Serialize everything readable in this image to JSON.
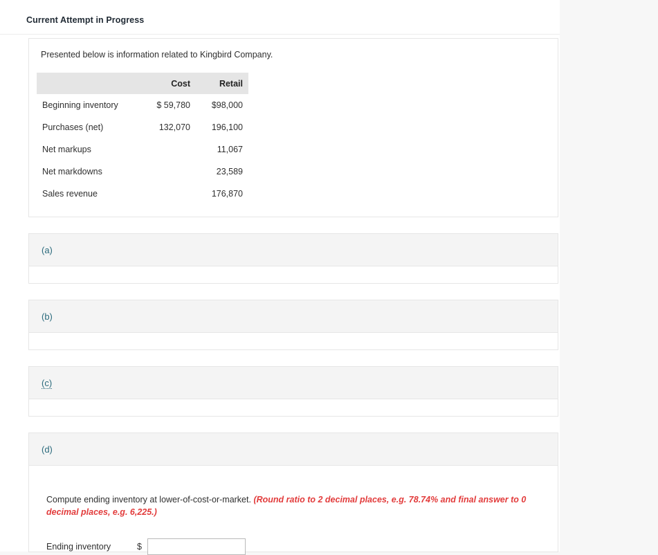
{
  "header": {
    "attempt_status": "Current Attempt in Progress"
  },
  "info_card": {
    "intro_text": "Presented below is information related to Kingbird Company.",
    "table": {
      "columns": [
        "",
        "Cost",
        "Retail"
      ],
      "rows": [
        {
          "label": "Beginning inventory",
          "cost": "$ 59,780",
          "retail": "$98,000"
        },
        {
          "label": "Purchases (net)",
          "cost": "132,070",
          "retail": "196,100"
        },
        {
          "label": "Net markups",
          "cost": "",
          "retail": "11,067"
        },
        {
          "label": "Net markdowns",
          "cost": "",
          "retail": "23,589"
        },
        {
          "label": "Sales revenue",
          "cost": "",
          "retail": "176,870"
        }
      ]
    }
  },
  "sections": [
    {
      "letter": "(a)",
      "linked": false
    },
    {
      "letter": "(b)",
      "linked": false
    },
    {
      "letter": "(c)",
      "linked": true
    },
    {
      "letter": "(d)",
      "linked": false
    }
  ],
  "section_d": {
    "letter": "(d)",
    "prompt": "Compute ending inventory at lower-of-cost-or-market.",
    "hint": "(Round ratio to 2 decimal places, e.g. 78.74% and final answer to 0 decimal places, e.g. 6,225.)",
    "answer_label": "Ending inventory",
    "currency_symbol": "$",
    "answer_value": "",
    "answer_placeholder": ""
  },
  "colors": {
    "page_background": "#f7f7f7",
    "content_background": "#ffffff",
    "section_header": "#f4f4f4",
    "table_header": "#e5e5e5",
    "border": "#e6e6e6",
    "letter_link": "#2a6a7c",
    "hint_red": "#e23b3b",
    "text": "#2f2f2f"
  }
}
